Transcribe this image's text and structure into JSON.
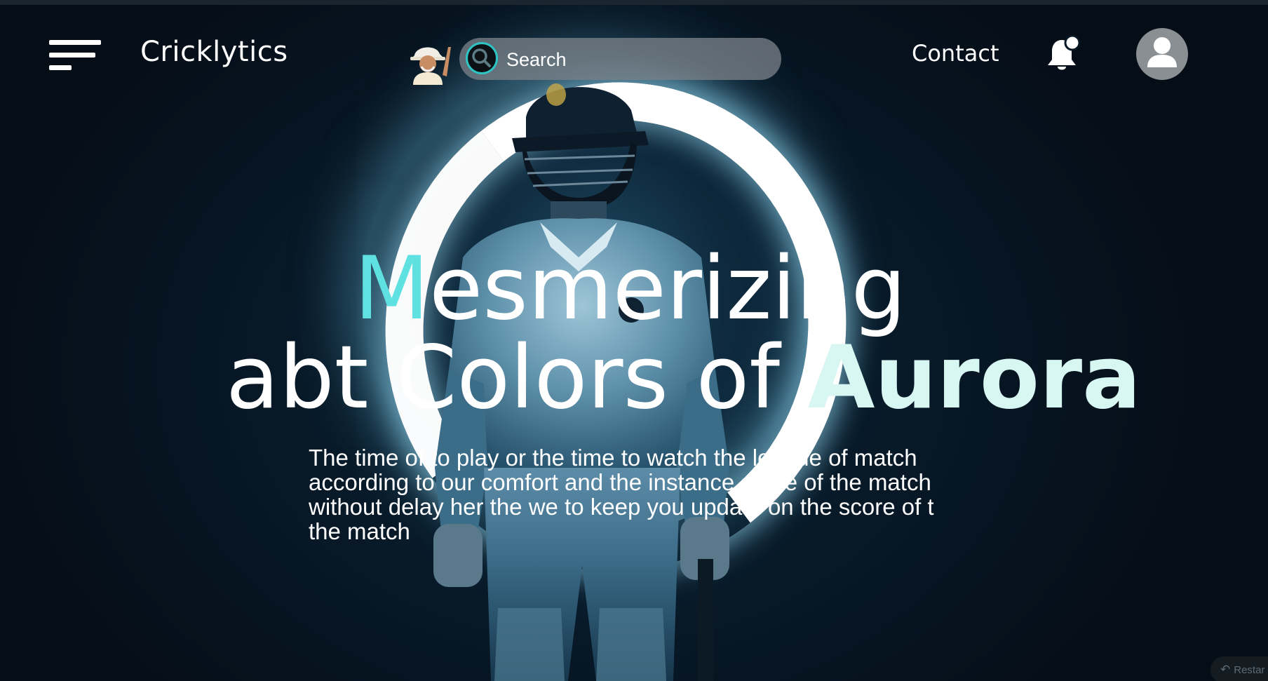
{
  "header": {
    "brand": "Cricklytics",
    "search": {
      "placeholder": "Search",
      "value": ""
    },
    "contact_label": "Contact",
    "icons": {
      "menu": "menu-icon",
      "mascot": "mascot-avatar",
      "search": "search-icon",
      "notification": "bell-icon",
      "profile": "profile-icon"
    }
  },
  "hero": {
    "line1_accent": "M",
    "line1_rest": "esmerizing",
    "line2_prefix": "abt Colors of ",
    "line2_accent_first": "A",
    "line2_accent_rest": "urora",
    "body": "The time of to play or the time to watch the league of match according to our comfort and the instance score of the match without delay her the we to keep you update on the score of t the match"
  },
  "restart_label": "Restar",
  "colors": {
    "accent_cyan": "#5fe1e1",
    "accent_mint": "#d8f6f2",
    "search_ring": "#2ec4c4",
    "background": "#050b12"
  }
}
